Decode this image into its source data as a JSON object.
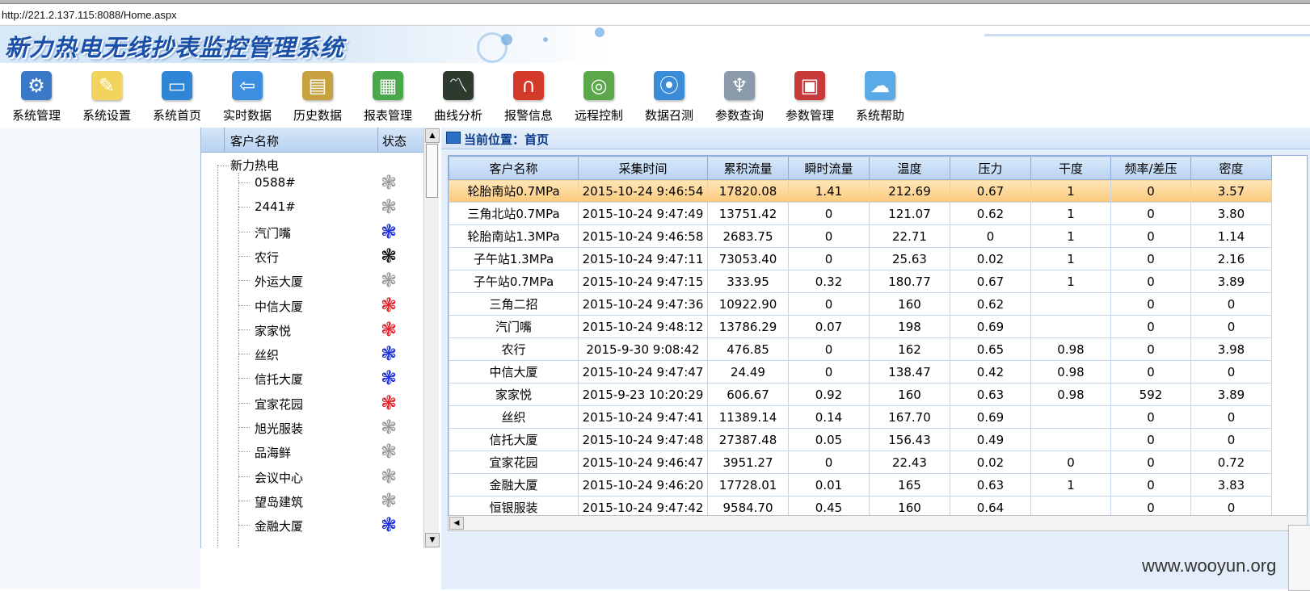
{
  "browser": {
    "url": "http://221.2.137.115:8088/Home.aspx"
  },
  "banner": {
    "title": "新力热电无线抄表监控管理系统"
  },
  "toolbar": {
    "items": [
      {
        "label": "系统管理",
        "icon": "computer-settings-icon",
        "color": "#3a78c8"
      },
      {
        "label": "系统设置",
        "icon": "sticky-note-icon",
        "color": "#f2d35e"
      },
      {
        "label": "系统首页",
        "icon": "monitor-icon",
        "color": "#2f86d6"
      },
      {
        "label": "实时数据",
        "icon": "monitor-arrow-icon",
        "color": "#3c8fe0"
      },
      {
        "label": "历史数据",
        "icon": "binders-icon",
        "color": "#c8a240"
      },
      {
        "label": "报表管理",
        "icon": "report-stack-icon",
        "color": "#4aa84a"
      },
      {
        "label": "曲线分析",
        "icon": "chart-screen-icon",
        "color": "#2f3a2f"
      },
      {
        "label": "报警信息",
        "icon": "magnet-icon",
        "color": "#d43a2a"
      },
      {
        "label": "远程控制",
        "icon": "target-icon",
        "color": "#5aa84a"
      },
      {
        "label": "数据召测",
        "icon": "antenna-icon",
        "color": "#3a8cd8"
      },
      {
        "label": "参数查询",
        "icon": "signal-tower-icon",
        "color": "#8a9aaa"
      },
      {
        "label": "参数管理",
        "icon": "calendar-icon",
        "color": "#c83a3a"
      },
      {
        "label": "系统帮助",
        "icon": "speech-bubble-icon",
        "color": "#5aaae8"
      }
    ]
  },
  "tree": {
    "header": {
      "name": "客户名称",
      "status": "状态"
    },
    "root": "新力热电",
    "items": [
      {
        "name": "0588#",
        "status": "gray"
      },
      {
        "name": "2441#",
        "status": "gray"
      },
      {
        "name": "汽门嘴",
        "status": "blue"
      },
      {
        "name": "农行",
        "status": "black"
      },
      {
        "name": "外运大厦",
        "status": "gray"
      },
      {
        "name": "中信大厦",
        "status": "red"
      },
      {
        "name": "家家悦",
        "status": "red"
      },
      {
        "name": "丝织",
        "status": "blue"
      },
      {
        "name": "信托大厦",
        "status": "blue"
      },
      {
        "name": "宜家花园",
        "status": "red"
      },
      {
        "name": "旭光服装",
        "status": "gray"
      },
      {
        "name": "品海鲜",
        "status": "gray"
      },
      {
        "name": "会议中心",
        "status": "gray"
      },
      {
        "name": "望岛建筑",
        "status": "gray"
      },
      {
        "name": "金融大厦",
        "status": "blue"
      }
    ],
    "status_colors": {
      "gray": "#9a9a9a",
      "blue": "#1a2ee0",
      "black": "#111111",
      "red": "#e8202a"
    },
    "status_glyph": "❃"
  },
  "main": {
    "location_label": "当前位置：",
    "location_value": "首页",
    "columns": [
      "客户名称",
      "采集时间",
      "累积流量",
      "瞬时流量",
      "温度",
      "压力",
      "干度",
      "频率/差压",
      "密度"
    ],
    "rows": [
      [
        "轮胎南站0.7MPa",
        "2015-10-24 9:46:54",
        "17820.08",
        "1.41",
        "212.69",
        "0.67",
        "1",
        "0",
        "3.57"
      ],
      [
        "三角北站0.7MPa",
        "2015-10-24 9:47:49",
        "13751.42",
        "0",
        "121.07",
        "0.62",
        "1",
        "0",
        "3.80"
      ],
      [
        "轮胎南站1.3MPa",
        "2015-10-24 9:46:58",
        "2683.75",
        "0",
        "22.71",
        "0",
        "1",
        "0",
        "1.14"
      ],
      [
        "子午站1.3MPa",
        "2015-10-24 9:47:11",
        "73053.40",
        "0",
        "25.63",
        "0.02",
        "1",
        "0",
        "2.16"
      ],
      [
        "子午站0.7MPa",
        "2015-10-24 9:47:15",
        "333.95",
        "0.32",
        "180.77",
        "0.67",
        "1",
        "0",
        "3.89"
      ],
      [
        "三角二招",
        "2015-10-24 9:47:36",
        "10922.90",
        "0",
        "160",
        "0.62",
        "",
        "0",
        "0"
      ],
      [
        "汽门嘴",
        "2015-10-24 9:48:12",
        "13786.29",
        "0.07",
        "198",
        "0.69",
        "",
        "0",
        "0"
      ],
      [
        "农行",
        "2015-9-30 9:08:42",
        "476.85",
        "0",
        "162",
        "0.65",
        "0.98",
        "0",
        "3.98"
      ],
      [
        "中信大厦",
        "2015-10-24 9:47:47",
        "24.49",
        "0",
        "138.47",
        "0.42",
        "0.98",
        "0",
        "0"
      ],
      [
        "家家悦",
        "2015-9-23 10:20:29",
        "606.67",
        "0.92",
        "160",
        "0.63",
        "0.98",
        "592",
        "3.89"
      ],
      [
        "丝织",
        "2015-10-24 9:47:41",
        "11389.14",
        "0.14",
        "167.70",
        "0.69",
        "",
        "0",
        "0"
      ],
      [
        "信托大厦",
        "2015-10-24 9:47:48",
        "27387.48",
        "0.05",
        "156.43",
        "0.49",
        "",
        "0",
        "0"
      ],
      [
        "宜家花园",
        "2015-10-24 9:46:47",
        "3951.27",
        "0",
        "22.43",
        "0.02",
        "0",
        "0",
        "0.72"
      ],
      [
        "金融大厦",
        "2015-10-24 9:46:20",
        "17728.01",
        "0.01",
        "165",
        "0.63",
        "1",
        "0",
        "3.83"
      ],
      [
        "恒银服装",
        "2015-10-24 9:47:42",
        "9584.70",
        "0.45",
        "160",
        "0.64",
        "",
        "0",
        "0"
      ]
    ]
  },
  "watermark": "www.wooyun.org"
}
